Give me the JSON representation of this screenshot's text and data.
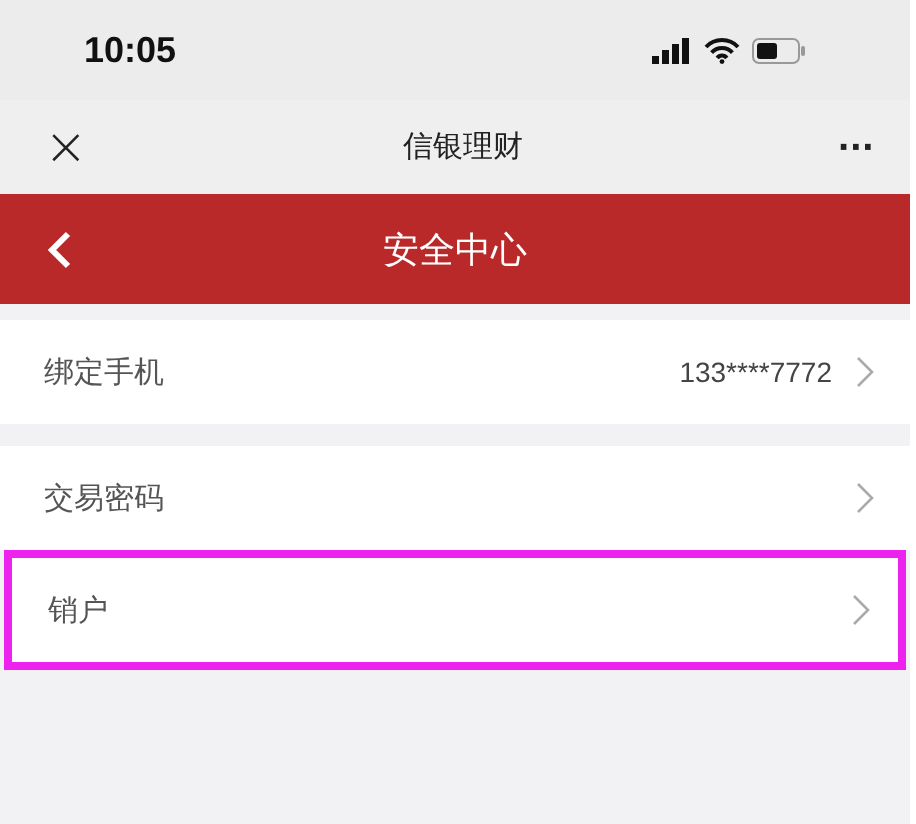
{
  "status_bar": {
    "time": "10:05"
  },
  "nav_bar": {
    "close": "×",
    "title": "信银理财",
    "more": "···"
  },
  "header": {
    "title": "安全中心"
  },
  "groups": [
    {
      "items": [
        {
          "label": "绑定手机",
          "value": "133****7772",
          "highlighted": false
        }
      ]
    },
    {
      "items": [
        {
          "label": "交易密码",
          "highlighted": false
        },
        {
          "label": "销户",
          "highlighted": true
        }
      ]
    }
  ]
}
